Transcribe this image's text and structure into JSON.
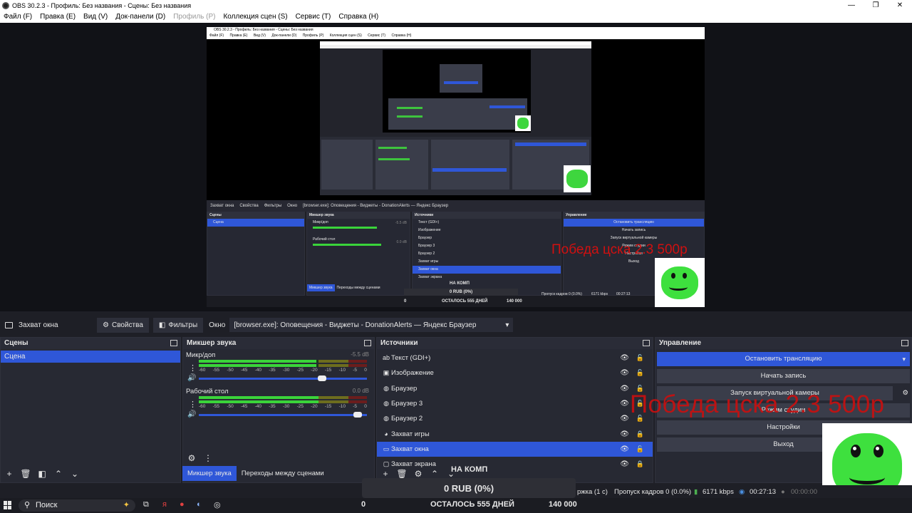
{
  "window": {
    "title": "OBS 30.2.3 - Профиль: Без названия - Сцены: Без названия",
    "controls": [
      "—",
      "❐",
      "✕"
    ]
  },
  "menu": [
    {
      "label": "Файл (F)",
      "disabled": false
    },
    {
      "label": "Правка (E)",
      "disabled": false
    },
    {
      "label": "Вид (V)",
      "disabled": false
    },
    {
      "label": "Док-панели (D)",
      "disabled": false
    },
    {
      "label": "Профиль (P)",
      "disabled": true
    },
    {
      "label": "Коллекция сцен (S)",
      "disabled": false
    },
    {
      "label": "Сервис (T)",
      "disabled": false
    },
    {
      "label": "Справка (H)",
      "disabled": false
    }
  ],
  "preview": {
    "title": "OBS 30.2.3 - Профиль: Без названия - Сцены: Без названия",
    "menu": [
      "Файл (F)",
      "Правка (E)",
      "Вид (V)",
      "Док-панели (D)",
      "Профиль (P)",
      "Коллекция сцен (S)",
      "Сервис (T)",
      "Справка (H)"
    ],
    "toolbar": {
      "source_name": "Захват окна",
      "properties": "Свойства",
      "filters": "Фильтры",
      "window_label": "Окно",
      "window_value": "[browser.exe]: Оповещения - Виджеты - DonationAlerts — Яндекс Браузер"
    },
    "docks": {
      "scenes_title": "Сцены",
      "scene_item": "Сцена",
      "mixer_title": "Микшер звука",
      "mixer_ch1": "Микр/доп",
      "mixer_ch1_db": "-5.5 dB",
      "mixer_ch2": "Рабочий стол",
      "mixer_ch2_db": "0.0 dB",
      "tab_mixer": "Микшер звука",
      "tab_transitions": "Переходы между сценами",
      "sources_title": "Источники",
      "sources": [
        "Текст (GDI+)",
        "Изображение",
        "Браузер",
        "Браузер 3",
        "Браузер 2",
        "Захват игры",
        "Захват окна",
        "Захват экрана"
      ],
      "controls_title": "Управление",
      "controls": [
        "Остановить трансляцию",
        "Начать запись",
        "Запуск виртуальной камеры",
        "Режим студии",
        "Настройки",
        "Выход"
      ]
    },
    "overlay_text": "Победа цска 2.3 500р",
    "na_comp": "НА КОМП",
    "donation": "0 RUB (0%)",
    "bar_left": "0",
    "bar_center": "ОСТАЛОСЬ 555 ДНЕЙ",
    "bar_right": "140 000",
    "status": {
      "dropped": "Пропуск кадров 0 (0.0%)",
      "kbps": "6171 kbps",
      "time": "00:27:13"
    }
  },
  "source_toolbar": {
    "source_name": "Захват окна",
    "properties_label": "Свойства",
    "filters_label": "Фильтры",
    "window_label": "Окно",
    "window_value": "[browser.exe]: Оповещения - Виджеты - DonationAlerts — Яндекс Браузер"
  },
  "scenes": {
    "title": "Сцены",
    "items": [
      "Сцена"
    ]
  },
  "mixer": {
    "title": "Микшер звука",
    "channels": [
      {
        "name": "Микр/доп",
        "db": "-5.5 dB",
        "level": 0.7,
        "volume": 0.76
      },
      {
        "name": "Рабочий стол",
        "db": "0.0 dB",
        "level": 0.72,
        "volume": 0.97
      }
    ],
    "ticks": [
      "-60",
      "-55",
      "-50",
      "-45",
      "-40",
      "-35",
      "-30",
      "-25",
      "-20",
      "-15",
      "-10",
      "-5",
      "0"
    ],
    "tabs": [
      "Микшер звука",
      "Переходы между сценами"
    ]
  },
  "sources": {
    "title": "Источники",
    "items": [
      {
        "name": "Текст (GDI+)",
        "icon": "text-icon",
        "glyph": "ab",
        "locked": false,
        "selected": false
      },
      {
        "name": "Изображение",
        "icon": "image-icon",
        "glyph": "▣",
        "locked": false,
        "selected": false
      },
      {
        "name": "Браузер",
        "icon": "globe-icon",
        "glyph": "◍",
        "locked": false,
        "selected": false
      },
      {
        "name": "Браузер 3",
        "icon": "globe-icon",
        "glyph": "◍",
        "locked": false,
        "selected": false
      },
      {
        "name": "Браузер 2",
        "icon": "globe-icon",
        "glyph": "◍",
        "locked": false,
        "selected": false
      },
      {
        "name": "Захват игры",
        "icon": "gamepad-icon",
        "glyph": "◕",
        "locked": true,
        "selected": false
      },
      {
        "name": "Захват окна",
        "icon": "window-icon",
        "glyph": "▭",
        "locked": false,
        "selected": true
      },
      {
        "name": "Захват экрана",
        "icon": "monitor-icon",
        "glyph": "▢",
        "locked": true,
        "selected": false
      }
    ]
  },
  "controls": {
    "title": "Управление",
    "stop_stream": "Остановить трансляцию",
    "start_record": "Начать запись",
    "virtual_cam": "Запуск виртуальной камеры",
    "studio_mode": "Режим студии",
    "settings": "Настройки",
    "exit": "Выход"
  },
  "overlay": {
    "red_text": "Победа цска 2.3 500р",
    "na_comp": "НА КОМП",
    "donation": "0 RUB (0%)",
    "progress_left": "0",
    "progress_center": "ОСТАЛОСЬ 555 ДНЕЙ",
    "progress_right": "140 000"
  },
  "status": {
    "delay": "ржка (1 с)",
    "dropped": "Пропуск кадров 0 (0.0%)",
    "kbps": "6171 kbps",
    "stream_time": "00:27:13",
    "record_time": "00:00:00"
  },
  "taskbar": {
    "search_placeholder": "Поиск"
  },
  "colors": {
    "accent": "#2f57d8",
    "overlay_red": "#c81010",
    "frog_green": "#3ee03e"
  }
}
